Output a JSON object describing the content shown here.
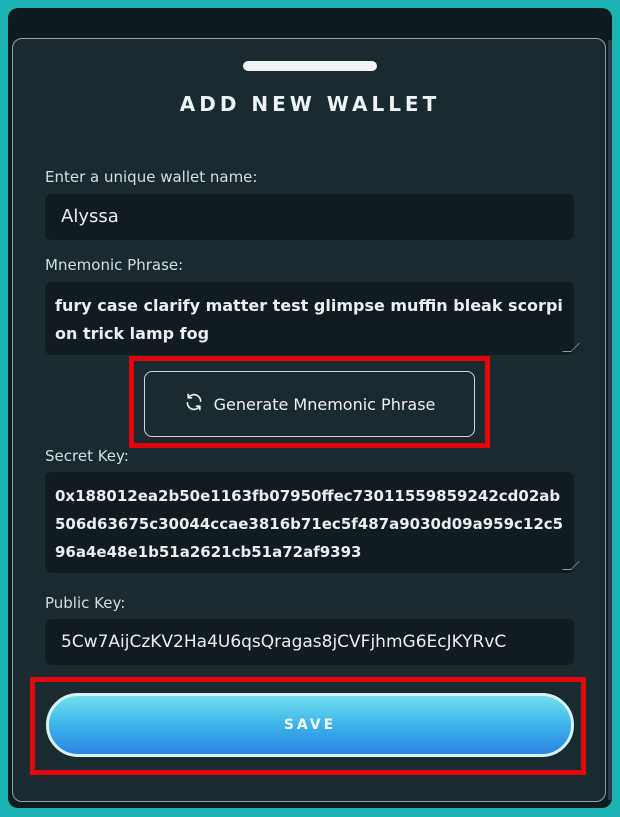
{
  "modal": {
    "title": "ADD NEW WALLET"
  },
  "wallet_name": {
    "label": "Enter a unique wallet name:",
    "value": "Alyssa"
  },
  "mnemonic": {
    "label": "Mnemonic Phrase:",
    "value": "fury case clarify matter test glimpse muffin bleak scorpion trick lamp fog"
  },
  "generate_button": {
    "label": "Generate Mnemonic Phrase",
    "icon": "refresh-icon"
  },
  "secret_key": {
    "label": "Secret Key:",
    "value": "0x188012ea2b50e1163fb07950ffec73011559859242cd02ab506d63675c30044ccae3816b71ec5f487a9030d09a959c12c596a4e48e1b51a2621cb51a72af9393"
  },
  "public_key": {
    "label": "Public Key:",
    "value": "5Cw7AijCzKV2Ha4U6qsQragas8jCVFjhmG6EcJKYRvC"
  },
  "save_button": {
    "label": "SAVE"
  },
  "colors": {
    "frame": "#1bb3b4",
    "modal_bg": "#1a2a31",
    "field_bg": "#111c21",
    "highlight": "#e3030b",
    "save_gradient_top": "#6fe1ee",
    "save_gradient_bottom": "#2a86e6"
  }
}
